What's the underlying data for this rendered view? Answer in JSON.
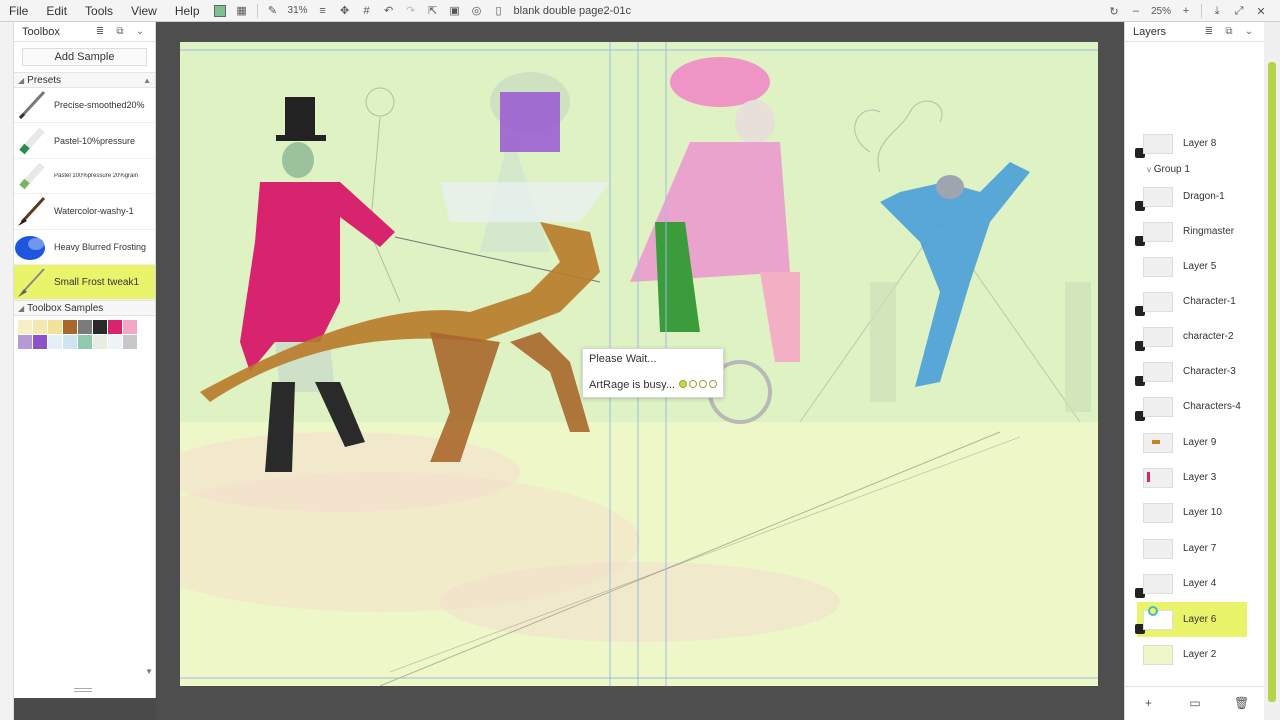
{
  "menubar": {
    "items": [
      "File",
      "Edit",
      "Tools",
      "View",
      "Help"
    ],
    "zoom": "31%",
    "doc_title": "blank double page2-01c",
    "right_zoom": "25%"
  },
  "toolbox": {
    "title": "Toolbox",
    "add_sample": "Add Sample",
    "presets_title": "Presets",
    "presets": [
      "Precise-smoothed20%",
      "Pastel-10%pressure",
      "Pastel 100%pressure 20%grain",
      "Watercolor-washy-1",
      "Heavy Blurred Frosting",
      "Small Frost tweak1"
    ],
    "samples_title": "Toolbox Samples",
    "swatches": [
      "#f6f0c4",
      "#f3e7b2",
      "#f1e19a",
      "#a9672c",
      "#7a7a7a",
      "#2a2a2a",
      "#d8246e",
      "#f4a6c6",
      "#b59ad8",
      "#8c52c9",
      "#e6eef7",
      "#cfe4ef",
      "#8fc9b0",
      "#e8ede2",
      "#eef4f6",
      "#c8c8c8"
    ]
  },
  "dialog": {
    "title": "Please Wait...",
    "busy": "ArtRage is busy..."
  },
  "layers": {
    "title": "Layers",
    "group": "Group 1",
    "items": [
      "Layer 8",
      "Dragon-1",
      "Ringmaster",
      "Layer 5",
      "Character-1",
      "character-2",
      "Character-3",
      "Characters-4",
      "Layer 9",
      "Layer 3",
      "Layer 10",
      "Layer 7",
      "Layer 4",
      "Layer 6",
      "Layer 2"
    ],
    "selected": "Layer 6"
  }
}
